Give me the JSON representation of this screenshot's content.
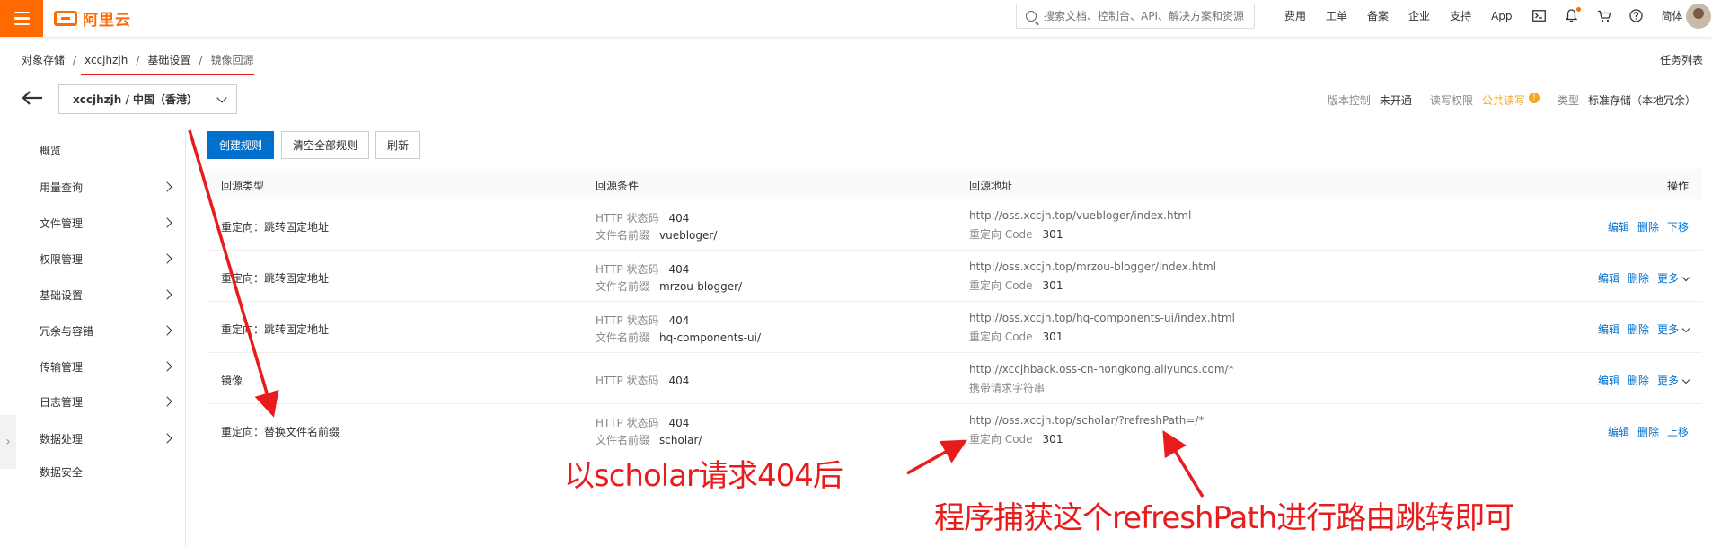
{
  "header": {
    "logo_text": "阿里云",
    "search_placeholder": "搜索文档、控制台、API、解决方案和资源",
    "nav": [
      "费用",
      "工单",
      "备案",
      "企业",
      "支持",
      "App"
    ],
    "lang": "简体"
  },
  "breadcrumb": [
    "对象存储",
    "xccjhzjh",
    "基础设置",
    "镜像回源"
  ],
  "task_list": "任务列表",
  "bucket": {
    "selected": "xccjhzjh / 中国（香港）"
  },
  "meta": {
    "version_label": "版本控制",
    "version_value": "未开通",
    "acl_label": "读写权限",
    "acl_value": "公共读写",
    "type_label": "类型",
    "type_value": "标准存储（本地冗余）"
  },
  "sidebar": {
    "items": [
      {
        "label": "概览",
        "chevron": false
      },
      {
        "label": "用量查询",
        "chevron": true
      },
      {
        "label": "文件管理",
        "chevron": true
      },
      {
        "label": "权限管理",
        "chevron": true
      },
      {
        "label": "基础设置",
        "chevron": true
      },
      {
        "label": "冗余与容错",
        "chevron": true
      },
      {
        "label": "传输管理",
        "chevron": true
      },
      {
        "label": "日志管理",
        "chevron": true
      },
      {
        "label": "数据处理",
        "chevron": true
      },
      {
        "label": "数据安全",
        "chevron": false
      }
    ]
  },
  "toolbar": {
    "create": "创建规则",
    "clear": "清空全部规则",
    "refresh": "刷新"
  },
  "table": {
    "headers": [
      "回源类型",
      "回源条件",
      "回源地址",
      "操作"
    ],
    "http_label": "HTTP 状态码",
    "prefix_label": "文件名前缀",
    "code_label": "重定向 Code",
    "rows": [
      {
        "type": "重定向：跳转固定地址",
        "status": "404",
        "prefix": "vuebloger/",
        "url": "http://oss.xccjh.top/vuebloger/index.html",
        "sub_value": "301",
        "ops": [
          "编辑",
          "删除",
          "下移"
        ],
        "more": false
      },
      {
        "type": "重定向：跳转固定地址",
        "status": "404",
        "prefix": "mrzou-blogger/",
        "url": "http://oss.xccjh.top/mrzou-blogger/index.html",
        "sub_value": "301",
        "ops": [
          "编辑",
          "删除",
          "更多"
        ],
        "more": true
      },
      {
        "type": "重定向：跳转固定地址",
        "status": "404",
        "prefix": "hq-components-ui/",
        "url": "http://oss.xccjh.top/hq-components-ui/index.html",
        "sub_value": "301",
        "ops": [
          "编辑",
          "删除",
          "更多"
        ],
        "more": true
      },
      {
        "type": "镜像",
        "status": "404",
        "prefix": null,
        "url": "http://xccjhback.oss-cn-hongkong.aliyuncs.com/*",
        "sub_text": "携带请求字符串",
        "ops": [
          "编辑",
          "删除",
          "更多"
        ],
        "more": true
      },
      {
        "type": "重定向：替换文件名前缀",
        "status": "404",
        "prefix": "scholar/",
        "url": "http://oss.xccjh.top/scholar/?refreshPath=/*",
        "sub_value": "301",
        "ops": [
          "编辑",
          "删除",
          "上移"
        ],
        "more": false
      }
    ]
  },
  "annotations": {
    "note1": "以scholar请求404后",
    "note2": "程序捕获这个refreshPath进行路由跳转即可",
    "color": "#e81c1c"
  },
  "colors": {
    "brand": "#ff6a00",
    "primary": "#0070cc",
    "warning": "#f5a623"
  }
}
